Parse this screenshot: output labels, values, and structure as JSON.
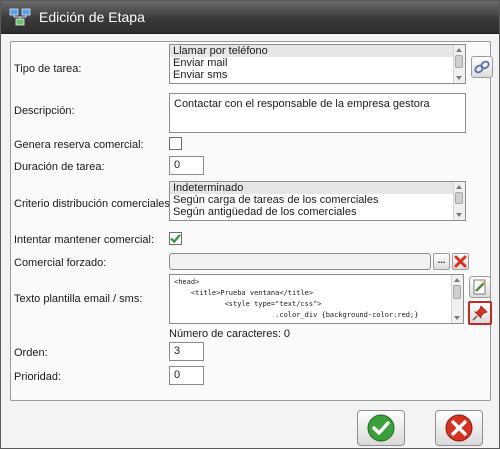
{
  "window": {
    "title": "Edición de Etapa",
    "title_icon": "network-icon"
  },
  "form": {
    "tipo_tarea": {
      "label": "Tipo de tarea:",
      "options": [
        "Llamar por teléfono",
        "Enviar mail",
        "Enviar sms"
      ],
      "selected": "Llamar por teléfono"
    },
    "descripcion": {
      "label": "Descripción:",
      "value": "Contactar con el responsable de la empresa gestora"
    },
    "genera_reserva": {
      "label": "Genera reserva comercial:",
      "checked": false
    },
    "duracion": {
      "label": "Duración de tarea:",
      "value": "0"
    },
    "criterio": {
      "label": "Criterio distribución comerciales:",
      "options": [
        "Indeterminado",
        "Según carga de tareas de los comerciales",
        "Según antigüedad de los comerciales"
      ],
      "selected": "Indeterminado"
    },
    "intentar_mantener": {
      "label": "Intentar mantener comercial:",
      "checked": true
    },
    "comercial_forzado": {
      "label": "Comercial forzado:",
      "value": "",
      "browse_label": "..."
    },
    "texto_plantilla": {
      "label": "Texto plantilla email / sms:",
      "lines": [
        "<head>",
        "    <title>Prueba ventana</title>",
        "            <style type=\"text/css\">",
        "                        .color_div {background-color:red;}",
        "                    ..."
      ],
      "char_count": "Número de caracteres: 0"
    },
    "orden": {
      "label": "Orden:",
      "value": "3"
    },
    "prioridad": {
      "label": "Prioridad:",
      "value": "0"
    }
  },
  "colors": {
    "accept": "#3aa13a",
    "cancel": "#d9301f",
    "highlight_border": "#c8281e"
  }
}
